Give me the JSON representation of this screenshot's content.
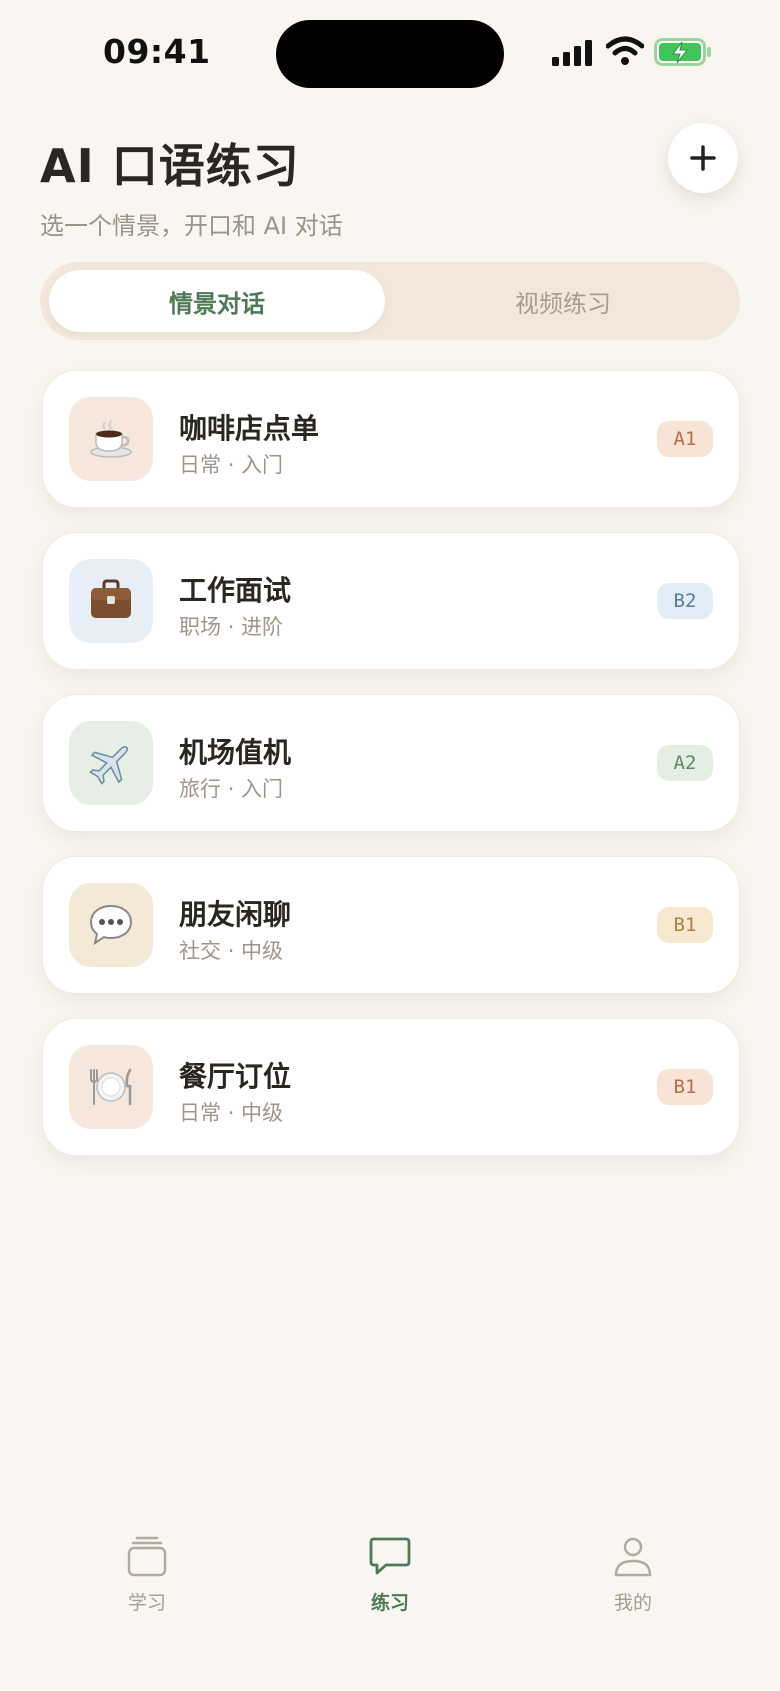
{
  "status_bar": {
    "time": "09:41"
  },
  "header": {
    "title": "AI 口语练习",
    "subtitle": "选一个情景，开口和 AI 对话",
    "add_icon": "plus-icon"
  },
  "tabs": [
    {
      "label": "情景对话",
      "active": true
    },
    {
      "label": "视频练习",
      "active": false
    }
  ],
  "scenarios": [
    {
      "title": "咖啡店点单",
      "category": "日常",
      "level_text": "入门",
      "level": "A1",
      "icon": "coffee-icon",
      "icon_bg": "#f6e7dc",
      "badge_bg": "#f8e4d6",
      "badge_color": "#b86b45"
    },
    {
      "title": "工作面试",
      "category": "职场",
      "level_text": "进阶",
      "level": "B2",
      "icon": "briefcase-icon",
      "icon_bg": "#e7eef5",
      "badge_bg": "#e3edf5",
      "badge_color": "#5a7a99"
    },
    {
      "title": "机场值机",
      "category": "旅行",
      "level_text": "入门",
      "level": "A2",
      "icon": "airplane-icon",
      "icon_bg": "#e6eee6",
      "badge_bg": "#e3efe3",
      "badge_color": "#5e8a62"
    },
    {
      "title": "朋友闲聊",
      "category": "社交",
      "level_text": "中级",
      "level": "B1",
      "icon": "speech-bubble-icon",
      "icon_bg": "#f4e8d6",
      "badge_bg": "#f5e8cf",
      "badge_color": "#a78442"
    },
    {
      "title": "餐厅订位",
      "category": "日常",
      "level_text": "中级",
      "level": "B1",
      "icon": "plate-cutlery-icon",
      "icon_bg": "#f6e7dc",
      "badge_bg": "#f8e4d6",
      "badge_color": "#b86b45"
    }
  ],
  "separator": "·",
  "bottom_nav": [
    {
      "label": "学习",
      "icon": "stack-icon",
      "active": false
    },
    {
      "label": "练习",
      "icon": "chat-icon",
      "active": true
    },
    {
      "label": "我的",
      "icon": "person-icon",
      "active": false
    }
  ],
  "colors": {
    "accent": "#4e7a56",
    "background": "#f9f6f1",
    "inactive": "#a89c8c"
  }
}
